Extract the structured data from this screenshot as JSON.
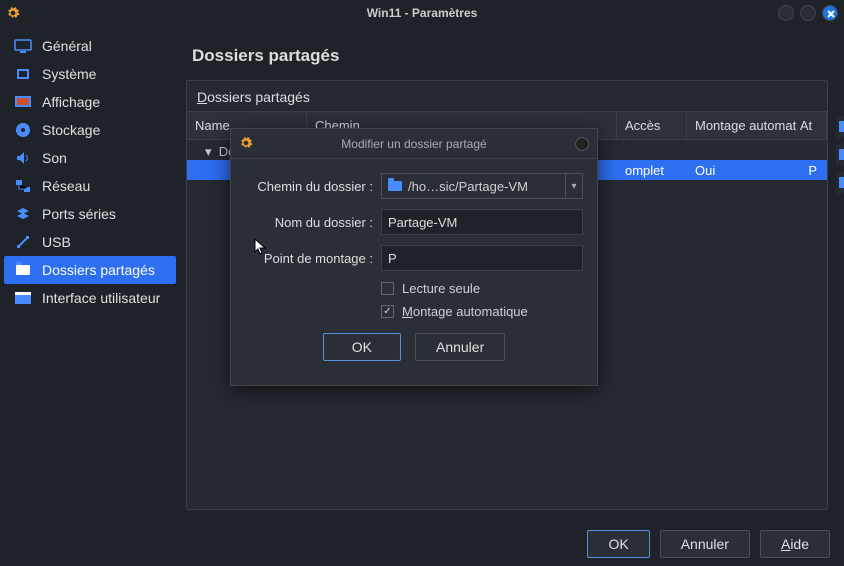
{
  "window": {
    "title": "Win11 - Paramètres"
  },
  "sidebar": {
    "items": [
      {
        "label": "Général"
      },
      {
        "label": "Système"
      },
      {
        "label": "Affichage"
      },
      {
        "label": "Stockage"
      },
      {
        "label": "Son"
      },
      {
        "label": "Réseau"
      },
      {
        "label": "Ports séries"
      },
      {
        "label": "USB"
      },
      {
        "label": "Dossiers partagés"
      },
      {
        "label": "Interface utilisateur"
      }
    ]
  },
  "content": {
    "header": "Dossiers partagés",
    "panel_title_prefix": "D",
    "panel_title_rest": "ossiers partagés",
    "columns": {
      "name": "Name",
      "path": "Chemin",
      "access": "Accès",
      "auto": "Montage automat",
      "at": "At"
    },
    "row": {
      "name_prefix": "Do",
      "access": "omplet",
      "auto": "Oui",
      "at": "P"
    }
  },
  "dialog": {
    "title": "Modifier un dossier partagé",
    "labels": {
      "path": "Chemin du dossier :",
      "name": "Nom du dossier :",
      "mount": "Point de montage :",
      "readonly": "Lecture seule",
      "automount_prefix": "M",
      "automount_rest": "ontage automatique"
    },
    "values": {
      "path": "/ho…sic/Partage-VM",
      "name": "Partage-VM",
      "mount": "P",
      "readonly_checked": false,
      "automount_checked": true
    },
    "buttons": {
      "ok": "OK",
      "cancel": "Annuler"
    }
  },
  "footer": {
    "ok": "OK",
    "cancel": "Annuler",
    "help_prefix": "A",
    "help_rest": "ide"
  },
  "colors": {
    "accent": "#2d6ff0"
  }
}
